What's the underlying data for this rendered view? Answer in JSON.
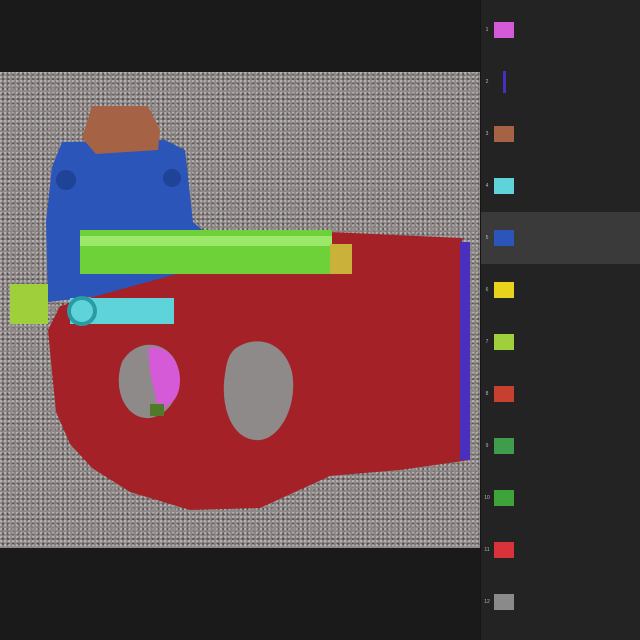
{
  "canvas": {
    "background": "#8e8a89",
    "parts": [
      {
        "name": "stock",
        "color": "#a42227"
      },
      {
        "name": "upper-receiver",
        "color": "#2b55b8"
      },
      {
        "name": "optic-housing",
        "color": "#a56244"
      },
      {
        "name": "barrel",
        "color": "#6fd13a"
      },
      {
        "name": "muzzle",
        "color": "#9fcf3a"
      },
      {
        "name": "charging-rail",
        "color": "#5fd3da"
      },
      {
        "name": "trigger-guard-insert",
        "color": "#d45ad8"
      },
      {
        "name": "butt-plate",
        "color": "#4a2fbf"
      },
      {
        "name": "barrel-lug",
        "color": "#c9b13a"
      }
    ]
  },
  "layers": [
    {
      "index": "1",
      "label": "",
      "thumb_color": "#d45ad8",
      "icon": "trigger-insert-thumb",
      "selected": false
    },
    {
      "index": "2",
      "label": "",
      "thumb_color": "#4a2fbf",
      "icon": "butt-plate-thumb",
      "selected": false
    },
    {
      "index": "3",
      "label": "",
      "thumb_color": "#a56244",
      "icon": "optic-thumb",
      "selected": false
    },
    {
      "index": "4",
      "label": "",
      "thumb_color": "#5fd3da",
      "icon": "rail-thumb",
      "selected": false
    },
    {
      "index": "5",
      "label": "",
      "thumb_color": "#2b55b8",
      "icon": "receiver-thumb",
      "selected": true
    },
    {
      "index": "6",
      "label": "",
      "thumb_color": "#e8d21c",
      "icon": "lug-thumb",
      "selected": false
    },
    {
      "index": "7",
      "label": "",
      "thumb_color": "#9fcf3a",
      "icon": "muzzle-thumb",
      "selected": false
    },
    {
      "index": "8",
      "label": "",
      "thumb_color": "#c7402f",
      "icon": "grip-thumb",
      "selected": false
    },
    {
      "index": "9",
      "label": "",
      "thumb_color": "#3f9c4a",
      "icon": "sling-thumb",
      "selected": false
    },
    {
      "index": "10",
      "label": "",
      "thumb_color": "#3ea33a",
      "icon": "barrel-thumb",
      "selected": false
    },
    {
      "index": "11",
      "label": "",
      "thumb_color": "#d8323a",
      "icon": "stock-thumb",
      "selected": false
    },
    {
      "index": "12",
      "label": "",
      "thumb_color": "#8a8a8a",
      "icon": "background-thumb",
      "selected": false
    }
  ]
}
